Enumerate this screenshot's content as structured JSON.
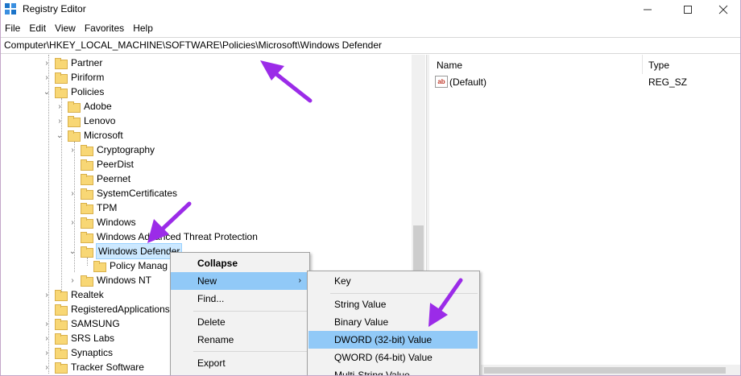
{
  "window": {
    "title": "Registry Editor"
  },
  "menu": [
    "File",
    "Edit",
    "View",
    "Favorites",
    "Help"
  ],
  "address": "Computer\\HKEY_LOCAL_MACHINE\\SOFTWARE\\Policies\\Microsoft\\Windows Defender",
  "tree": [
    {
      "label": "Partner",
      "chevron": "›",
      "expanded": false
    },
    {
      "label": "Piriform",
      "chevron": "›",
      "expanded": false
    },
    {
      "label": "Policies",
      "chevron": "⌄",
      "expanded": true
    },
    {
      "label": "Adobe",
      "chevron": "›",
      "expanded": false
    },
    {
      "label": "Lenovo",
      "chevron": "›",
      "expanded": false
    },
    {
      "label": "Microsoft",
      "chevron": "⌄",
      "expanded": true
    },
    {
      "label": "Cryptography",
      "chevron": "›",
      "expanded": false
    },
    {
      "label": "PeerDist",
      "chevron": "",
      "expanded": false
    },
    {
      "label": "Peernet",
      "chevron": "",
      "expanded": false
    },
    {
      "label": "SystemCertificates",
      "chevron": "›",
      "expanded": false
    },
    {
      "label": "TPM",
      "chevron": "",
      "expanded": false
    },
    {
      "label": "Windows",
      "chevron": "›",
      "expanded": false
    },
    {
      "label": "Windows Advanced Threat Protection",
      "chevron": "",
      "expanded": false
    },
    {
      "label": "Windows Defender",
      "chevron": "⌄",
      "expanded": true,
      "selected": true
    },
    {
      "label": "Policy Manag",
      "chevron": "",
      "expanded": false
    },
    {
      "label": "Windows NT",
      "chevron": "›",
      "expanded": false
    },
    {
      "label": "Realtek",
      "chevron": "›",
      "expanded": false
    },
    {
      "label": "RegisteredApplications",
      "chevron": "",
      "expanded": false
    },
    {
      "label": "SAMSUNG",
      "chevron": "›",
      "expanded": false
    },
    {
      "label": "SRS Labs",
      "chevron": "›",
      "expanded": false
    },
    {
      "label": "Synaptics",
      "chevron": "›",
      "expanded": false
    },
    {
      "label": "Tracker Software",
      "chevron": "›",
      "expanded": false
    }
  ],
  "columns": {
    "name": "Name",
    "type": "Type"
  },
  "values": [
    {
      "name": "(Default)",
      "type": "REG_SZ",
      "icon": "string-value-icon"
    }
  ],
  "context_menu": {
    "items": [
      {
        "label": "Collapse",
        "bold": true
      },
      {
        "label": "New",
        "submenu": true,
        "highlighted": true
      },
      {
        "label": "Find..."
      },
      {
        "label": "Delete"
      },
      {
        "label": "Rename"
      },
      {
        "label": "Export"
      }
    ]
  },
  "new_submenu": {
    "items": [
      {
        "label": "Key"
      },
      {
        "label": "String Value"
      },
      {
        "label": "Binary Value"
      },
      {
        "label": "DWORD (32-bit) Value",
        "highlighted": true
      },
      {
        "label": "QWORD (64-bit) Value"
      },
      {
        "label": "Multi-String Value"
      }
    ]
  },
  "colors": {
    "annotation_arrow": "#9b2be8",
    "highlight": "#91c9f7",
    "selection": "#cce8ff",
    "folder": "#f8d775"
  }
}
